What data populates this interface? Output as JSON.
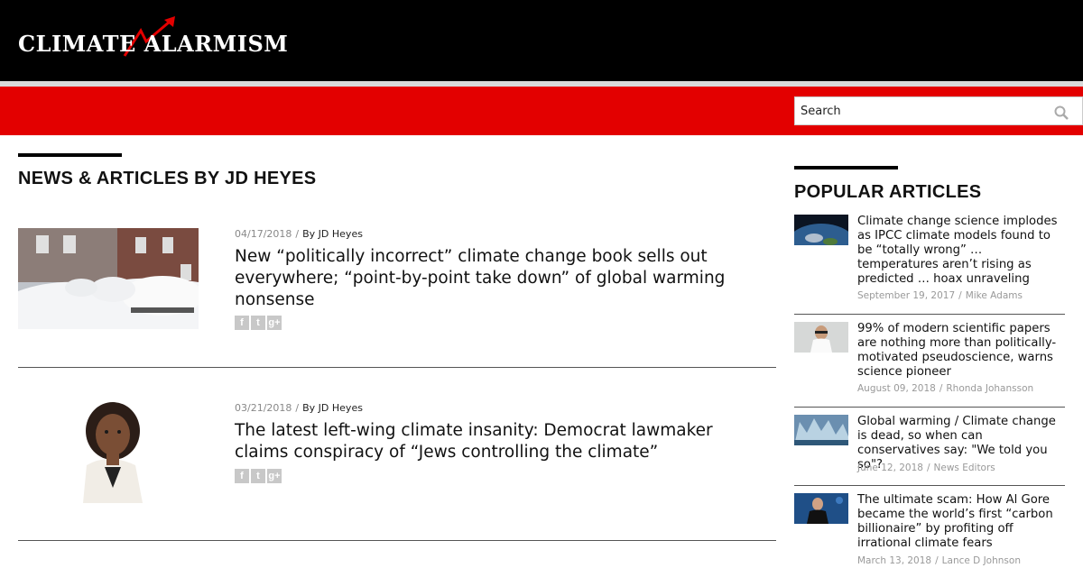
{
  "site": {
    "logo_text": "CLIMATE ALARMISM",
    "search_placeholder": "Search"
  },
  "main": {
    "page_title": "NEWS & ARTICLES BY JD HEYES",
    "articles": [
      {
        "date": "04/17/2018",
        "author": "By JD Heyes",
        "headline": "New “politically incorrect” climate change book sells out everywhere; “point-by-point take down” of global warming nonsense"
      },
      {
        "date": "03/21/2018",
        "author": "By JD Heyes",
        "headline": "The latest left-wing climate insanity: Democrat lawmaker claims conspiracy of “Jews controlling the climate”"
      }
    ],
    "share_icons": [
      "f",
      "t",
      "g+"
    ]
  },
  "sidebar": {
    "title": "POPULAR ARTICLES",
    "items": [
      {
        "title": "Climate change science implodes as IPCC climate models found to be “totally wrong” … temperatures aren’t rising as predicted … hoax unraveling",
        "date": "September 19, 2017",
        "author": "Mike Adams"
      },
      {
        "title": "99% of modern scientific papers are nothing more than politically-motivated pseudoscience, warns science pioneer",
        "date": "August 09, 2018",
        "author": "Rhonda Johansson"
      },
      {
        "title": "Global warming / Climate change is dead, so when can conservatives say: \"We told you so\"?",
        "date": "June 12, 2018",
        "author": "News Editors"
      },
      {
        "title": "The ultimate scam: How Al Gore became the world’s first “carbon billionaire” by profiting off irrational climate fears",
        "date": "March 13, 2018",
        "author": "Lance D Johnson"
      }
    ]
  },
  "colors": {
    "header": "#000000",
    "nav": "#e30000",
    "accent_red": "#e30000"
  }
}
